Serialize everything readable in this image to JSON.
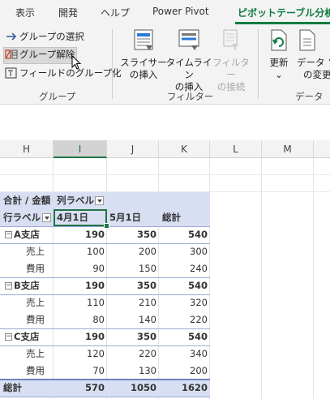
{
  "tabs": [
    {
      "label": "表示"
    },
    {
      "label": "開発"
    },
    {
      "label": "ヘルプ"
    },
    {
      "label": "Power Pivot"
    },
    {
      "label": "ピボットテーブル分析",
      "active": true
    }
  ],
  "ribbon": {
    "group_items": [
      "グループの選択",
      "グループ解除",
      "フィールドのグループ化"
    ],
    "group_label": "グループ",
    "filter_buttons": [
      {
        "line1": "スライサー",
        "line2": "の挿入",
        "enabled": true
      },
      {
        "line1": "タイムライン",
        "line2": "の挿入",
        "enabled": true
      },
      {
        "line1": "フィルター",
        "line2": "の接続",
        "enabled": false
      }
    ],
    "filter_label": "フィルター",
    "data_buttons": [
      {
        "line1": "更新",
        "line2": "⌄"
      },
      {
        "line1": "データ ソ",
        "line2": "の変更"
      }
    ],
    "data_label": "データ"
  },
  "columns": [
    "H",
    "I",
    "J",
    "K",
    "L",
    "M"
  ],
  "selected_column": "I",
  "pivot": {
    "header1": {
      "values_label": "合計 / 金額",
      "col_labels": "列ラベル"
    },
    "header2": {
      "row_labels": "行ラベル",
      "dates": [
        "4月1日",
        "5月1日"
      ],
      "total": "総計"
    },
    "groups": [
      {
        "name": "A支店",
        "values": [
          "190",
          "350",
          "540"
        ],
        "rows": [
          {
            "label": "売上",
            "values": [
              "100",
              "200",
              "300"
            ]
          },
          {
            "label": "費用",
            "values": [
              "90",
              "150",
              "240"
            ]
          }
        ]
      },
      {
        "name": "B支店",
        "values": [
          "190",
          "350",
          "540"
        ],
        "rows": [
          {
            "label": "売上",
            "values": [
              "110",
              "210",
              "320"
            ]
          },
          {
            "label": "費用",
            "values": [
              "80",
              "140",
              "220"
            ]
          }
        ]
      },
      {
        "name": "C支店",
        "values": [
          "190",
          "350",
          "540"
        ],
        "rows": [
          {
            "label": "売上",
            "values": [
              "120",
              "220",
              "340"
            ]
          },
          {
            "label": "費用",
            "values": [
              "70",
              "130",
              "200"
            ]
          }
        ]
      }
    ],
    "grand_total": {
      "label": "総計",
      "values": [
        "570",
        "1050",
        "1620"
      ]
    }
  },
  "colors": {
    "accent": "#107c41",
    "pivot_header": "#d9dff2",
    "pivot_line": "#9ba9d8"
  }
}
